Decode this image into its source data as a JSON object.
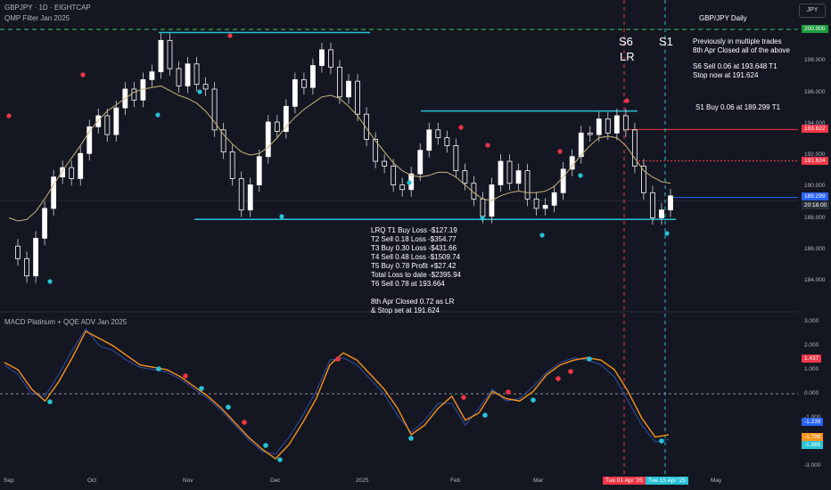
{
  "header": {
    "symbol_line": "GBPJPY · 1D · EIGHTCAP",
    "indicator_line": "QMP Filter Jan 2025",
    "lower_title": "MACD Platinum + QQE ADV Jan 2025",
    "currency_button": "JPY"
  },
  "annotations": {
    "title": "GBP/JPY Daily",
    "prev": "Previously in multiple trades\n8th Apr Closed all of the above",
    "s6_text": "S6 Sell 0.06 at 193.648 T1\nStop now at 191.624",
    "s1_text": "S1 Buy 0.06 at 189.299 T1",
    "trade_log": "LRQ T1 Buy Loss -$127.19\nT2 Sell 0.18 Loss -$354.77\nT3 Buy 0.30 Loss -$431.66\nT4 Sell 0.48 Loss -$1509.74\nT5 Buy 0.78 Profit +$27.42\nTotal Loss to date -$2395.94\nT6 Sell 0.78 at 193.664\n\n8th Apr Closed 0.72 as LR\n& Stop set at 191.624",
    "s6_label": "S6",
    "lr_label": "LR",
    "s1_label": "S1"
  },
  "colors": {
    "background": "#141722",
    "bull": "#ffffff",
    "bear": "#ffffff",
    "sma": "#c8b27a",
    "support": "#27c2d6",
    "green_dash": "#3ec45f",
    "red_level": "#f23645",
    "blue_level": "#2962ff",
    "macd_orange": "#f7931a",
    "macd_blue": "#2f4fa8"
  },
  "price_badges": [
    {
      "text": "200.000",
      "color": "#1b9e3e"
    },
    {
      "text": "193.622",
      "color": "#f23645"
    },
    {
      "text": "191.624",
      "color": "#f23645"
    },
    {
      "text": "189.299",
      "color": "#2962ff"
    },
    {
      "text": "20:18:00",
      "color": "#2a2e39"
    }
  ],
  "macd_badges": [
    {
      "text": "1.437",
      "color": "#f23645"
    },
    {
      "text": "-1.239",
      "color": "#2962ff"
    },
    {
      "text": "-1.798",
      "color": "#f7931a"
    },
    {
      "text": "-1.985",
      "color": "#27c2d6"
    }
  ],
  "date_badges": [
    {
      "text": "Tue 01 Apr '25",
      "color": "#f23645"
    },
    {
      "text": "Tue 15 Apr '25",
      "color": "#27c2d6"
    }
  ],
  "chart_data": [
    {
      "type": "candlestick",
      "title": "GBPJPY · 1D · EIGHTCAP",
      "y_ticks": [
        184.0,
        186.0,
        188.0,
        190.0,
        192.0,
        194.0,
        196.0,
        198.0
      ],
      "x_ticks": [
        "Sep",
        "Oct",
        "Nov",
        "Dec",
        "2025",
        "Feb",
        "Mar",
        "Apr",
        "May"
      ],
      "levels": {
        "green_dashed": 200.0,
        "red_stop_entry": 193.622,
        "red_stop": 191.624,
        "blue_entry": 189.299,
        "upper_resistance_1": 199.8,
        "upper_resistance_2": 194.8,
        "support": 187.9
      },
      "series": [
        {
          "name": "price_path",
          "values": [
            186.2,
            185.4,
            184.3,
            186.7,
            188.6,
            190.6,
            191.2,
            190.5,
            192.1,
            193.8,
            194.5,
            193.3,
            195.0,
            196.2,
            195.5,
            196.8,
            197.3,
            199.3,
            197.5,
            196.4,
            197.8,
            196.5,
            196.2,
            193.6,
            192.2,
            190.5,
            188.5,
            190.1,
            191.9,
            194.1,
            193.5,
            195.1,
            196.8,
            196.3,
            197.7,
            198.7,
            197.6,
            195.7,
            196.7,
            194.6,
            193.0,
            191.6,
            191.3,
            190.1,
            189.8,
            190.8,
            192.3,
            193.6,
            193.1,
            192.6,
            191.0,
            190.2,
            189.2,
            188.1,
            190.1,
            191.6,
            190.2,
            191.0,
            189.2,
            188.6,
            188.8,
            189.6,
            191.1,
            191.9,
            193.4,
            193.3,
            194.3,
            193.4,
            194.5,
            193.6,
            191.3,
            189.6,
            188.0,
            188.5,
            189.4
          ]
        },
        {
          "name": "sma",
          "values": [
            188.0,
            187.8,
            187.9,
            188.4,
            189.2,
            190.1,
            191.0,
            191.8,
            192.6,
            193.5,
            194.2,
            194.8,
            195.2,
            195.6,
            196.0,
            196.2,
            196.3,
            196.4,
            196.1,
            195.8,
            195.6,
            195.3,
            194.8,
            194.1,
            193.3,
            192.7,
            192.2,
            192.0,
            192.1,
            192.5,
            193.1,
            193.8,
            194.4,
            194.9,
            195.3,
            195.7,
            195.8,
            195.6,
            195.1,
            194.5,
            193.7,
            192.9,
            192.2,
            191.5,
            191.0,
            190.7,
            190.6,
            190.7,
            190.9,
            190.9,
            190.6,
            190.1,
            189.6,
            189.2,
            189.1,
            189.4,
            189.6,
            189.7,
            189.6,
            189.6,
            189.7,
            190.0,
            190.6,
            191.3,
            192.0,
            192.6,
            193.1,
            193.2,
            193.1,
            192.6,
            191.8,
            191.0,
            190.6,
            190.3,
            190.2
          ]
        }
      ]
    },
    {
      "type": "line",
      "title": "MACD Platinum + QQE ADV Jan 2025",
      "y_ticks": [
        3.0,
        2.0,
        1.0,
        0.0,
        -1.0,
        -2.0,
        -3.0
      ],
      "ylim": [
        -3.0,
        3.0
      ],
      "series": [
        {
          "name": "macd",
          "values": [
            1.3,
            1.0,
            0.2,
            -0.3,
            0.5,
            1.5,
            2.6,
            2.3,
            2.0,
            1.6,
            1.2,
            1.1,
            1.0,
            0.7,
            0.3,
            -0.1,
            -0.6,
            -1.2,
            -1.8,
            -2.3,
            -2.7,
            -2.1,
            -1.2,
            -0.2,
            1.2,
            1.7,
            1.4,
            0.8,
            0.2,
            -0.6,
            -1.7,
            -1.3,
            -0.6,
            -0.1,
            -1.1,
            -0.8,
            0.1,
            -0.2,
            -0.3,
            0.1,
            0.8,
            1.2,
            1.4,
            1.5,
            1.4,
            1.0,
            0.1,
            -1.0,
            -1.8,
            -1.7
          ]
        },
        {
          "name": "signal",
          "values": [
            1.2,
            0.8,
            0.0,
            -0.1,
            0.8,
            1.8,
            2.7,
            2.0,
            1.8,
            1.4,
            1.1,
            1.0,
            0.9,
            0.6,
            0.2,
            -0.2,
            -0.7,
            -1.3,
            -1.9,
            -2.4,
            -2.5,
            -1.8,
            -0.9,
            0.1,
            1.4,
            1.5,
            1.2,
            0.6,
            0.0,
            -0.9,
            -1.6,
            -1.1,
            -0.4,
            -0.4,
            -1.3,
            -0.6,
            0.2,
            -0.3,
            -0.2,
            0.3,
            0.9,
            1.3,
            1.5,
            1.4,
            1.2,
            0.7,
            -0.3,
            -1.3,
            -2.0,
            -1.9
          ]
        }
      ]
    }
  ]
}
